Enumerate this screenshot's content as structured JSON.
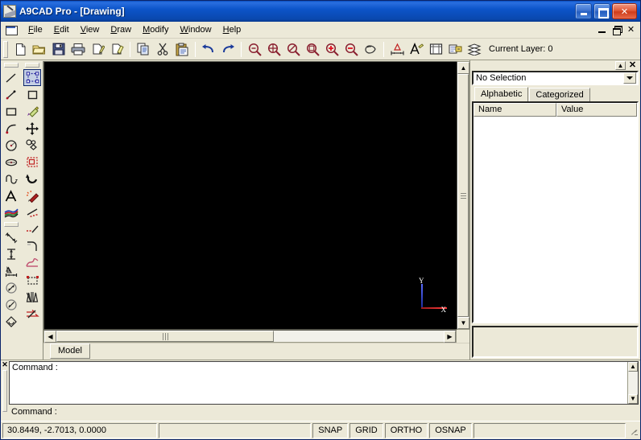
{
  "window": {
    "title": "A9CAD Pro - [Drawing]",
    "icon": "app-icon",
    "buttons": {
      "minimize": "",
      "maximize": "",
      "close": "✕"
    }
  },
  "menubar": {
    "doc_icon": "document-icon",
    "items": [
      {
        "accel": "F",
        "rest": "ile"
      },
      {
        "accel": "E",
        "rest": "dit"
      },
      {
        "accel": "V",
        "rest": "iew"
      },
      {
        "accel": "D",
        "rest": "raw"
      },
      {
        "accel": "M",
        "rest": "odify"
      },
      {
        "accel": "W",
        "rest": "indow"
      },
      {
        "accel": "H",
        "rest": "elp"
      }
    ],
    "mdi_buttons": {
      "minimize": "",
      "restore": "",
      "close": "✕"
    }
  },
  "toolbar": {
    "layer_label": "Current Layer: 0",
    "items": [
      {
        "name": "new-file-icon",
        "tip": "New"
      },
      {
        "name": "open-file-icon",
        "tip": "Open"
      },
      {
        "name": "save-file-icon",
        "tip": "Save"
      },
      {
        "name": "print-icon",
        "tip": "Print"
      },
      {
        "name": "print-preview-icon",
        "tip": "Print Preview"
      },
      {
        "name": "format-painter-icon",
        "tip": "Format Painter"
      },
      {
        "name": "copy-icon",
        "tip": "Copy"
      },
      {
        "name": "cut-icon",
        "tip": "Cut"
      },
      {
        "name": "paste-icon",
        "tip": "Paste"
      },
      {
        "name": "undo-icon",
        "tip": "Undo"
      },
      {
        "name": "redo-icon",
        "tip": "Redo"
      },
      {
        "name": "zoom-previous-icon",
        "tip": "Zoom Previous"
      },
      {
        "name": "zoom-all-icon",
        "tip": "Zoom All"
      },
      {
        "name": "zoom-extents-icon",
        "tip": "Zoom Extents"
      },
      {
        "name": "zoom-window-icon",
        "tip": "Zoom Window"
      },
      {
        "name": "zoom-in-icon",
        "tip": "Zoom In"
      },
      {
        "name": "zoom-out-icon",
        "tip": "Zoom Out"
      },
      {
        "name": "pan-icon",
        "tip": "Pan"
      },
      {
        "name": "dimension-style-icon",
        "tip": "Dimension Style"
      },
      {
        "name": "text-style-icon",
        "tip": "Text Style"
      },
      {
        "name": "drawing-settings-icon",
        "tip": "Drawing Settings"
      },
      {
        "name": "properties-icon",
        "tip": "Properties"
      },
      {
        "name": "layers-icon",
        "tip": "Layers"
      }
    ]
  },
  "draw_toolbar": {
    "name": "draw-toolbar",
    "items": [
      {
        "name": "line-icon",
        "tip": "Line"
      },
      {
        "name": "construction-line-icon",
        "tip": "Construction Line"
      },
      {
        "name": "rectangle-icon",
        "tip": "Rectangle"
      },
      {
        "name": "arc-icon",
        "tip": "Arc"
      },
      {
        "name": "circle-icon",
        "tip": "Circle"
      },
      {
        "name": "ellipse-icon",
        "tip": "Ellipse"
      },
      {
        "name": "polyline-icon",
        "tip": "Polyline"
      },
      {
        "name": "text-icon",
        "tip": "Text"
      },
      {
        "name": "hatch-icon",
        "tip": "Hatch"
      },
      {
        "name": "dim-aligned-icon",
        "tip": "Aligned Dimension"
      },
      {
        "name": "dim-vertical-icon",
        "tip": "Vertical Dimension"
      },
      {
        "name": "dim-linear-icon",
        "tip": "Linear Dimension"
      },
      {
        "name": "dim-diameter-icon",
        "tip": "Diameter Dimension"
      },
      {
        "name": "dim-radius-icon",
        "tip": "Radius Dimension"
      },
      {
        "name": "dim-angular-icon",
        "tip": "Angular Dimension"
      }
    ]
  },
  "modify_toolbar": {
    "name": "modify-toolbar",
    "selected_index": 0,
    "items": [
      {
        "name": "select-icon",
        "tip": "Select"
      },
      {
        "name": "erase-icon",
        "tip": "Erase"
      },
      {
        "name": "match-properties-icon",
        "tip": "Match Properties"
      },
      {
        "name": "move-icon",
        "tip": "Move"
      },
      {
        "name": "copy-object-icon",
        "tip": "Copy Object"
      },
      {
        "name": "scale-icon",
        "tip": "Scale"
      },
      {
        "name": "rotate-icon",
        "tip": "Rotate"
      },
      {
        "name": "explode-icon",
        "tip": "Explode"
      },
      {
        "name": "trim-icon",
        "tip": "Trim"
      },
      {
        "name": "extend-icon",
        "tip": "Extend"
      },
      {
        "name": "fillet-icon",
        "tip": "Fillet"
      },
      {
        "name": "chamfer-icon",
        "tip": "Chamfer"
      },
      {
        "name": "stretch-icon",
        "tip": "Stretch"
      },
      {
        "name": "mirror-icon",
        "tip": "Mirror"
      },
      {
        "name": "offset-icon",
        "tip": "Offset"
      }
    ]
  },
  "canvas": {
    "name": "drawing-canvas",
    "background": "#000000",
    "ucs": {
      "x_label": "X",
      "y_label": "Y",
      "x_color": "#ff3b3b",
      "y_color": "#3a4cff"
    }
  },
  "tabs": {
    "model": "Model"
  },
  "properties": {
    "close_glyph": "✕",
    "collapse_glyph": "▲",
    "selection": "No Selection",
    "tabs": [
      {
        "label": "Alphabetic",
        "active": true
      },
      {
        "label": "Categorized",
        "active": false
      }
    ],
    "columns": {
      "name": "Name",
      "value": "Value"
    },
    "rows": []
  },
  "command_window": {
    "close_glyph": "✕",
    "history": "Command :",
    "prompt": "Command :"
  },
  "statusbar": {
    "coordinates": "30.8449, -2.7013, 0.0000",
    "modes": [
      "SNAP",
      "GRID",
      "ORTHO",
      "OSNAP"
    ],
    "message": ""
  }
}
